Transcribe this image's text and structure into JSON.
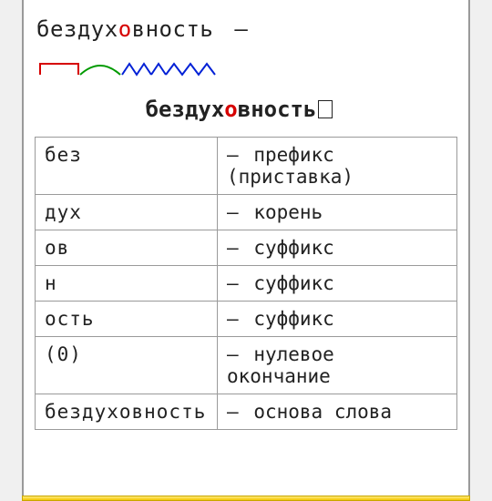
{
  "headword": {
    "pre": "бездух",
    "stress": "о",
    "post": "вность",
    "dash": "—"
  },
  "morph": {
    "pre": "бездух",
    "stress": "о",
    "post": "вность"
  },
  "svg": {
    "prefix_color": "#d60000",
    "root_color": "#009a00",
    "suffix_color": "#0020d6"
  },
  "rows": [
    {
      "name": "без",
      "desc": "префикс (приставка)"
    },
    {
      "name": "дух",
      "desc": "корень"
    },
    {
      "name": "ов",
      "desc": "суффикс"
    },
    {
      "name": "н",
      "desc": "суффикс"
    },
    {
      "name": "ость",
      "desc": "суффикс"
    },
    {
      "name": "(0)",
      "desc": "нулевое окончание"
    },
    {
      "name": "бездуховность",
      "desc": "основа слова"
    }
  ],
  "dash": "—"
}
